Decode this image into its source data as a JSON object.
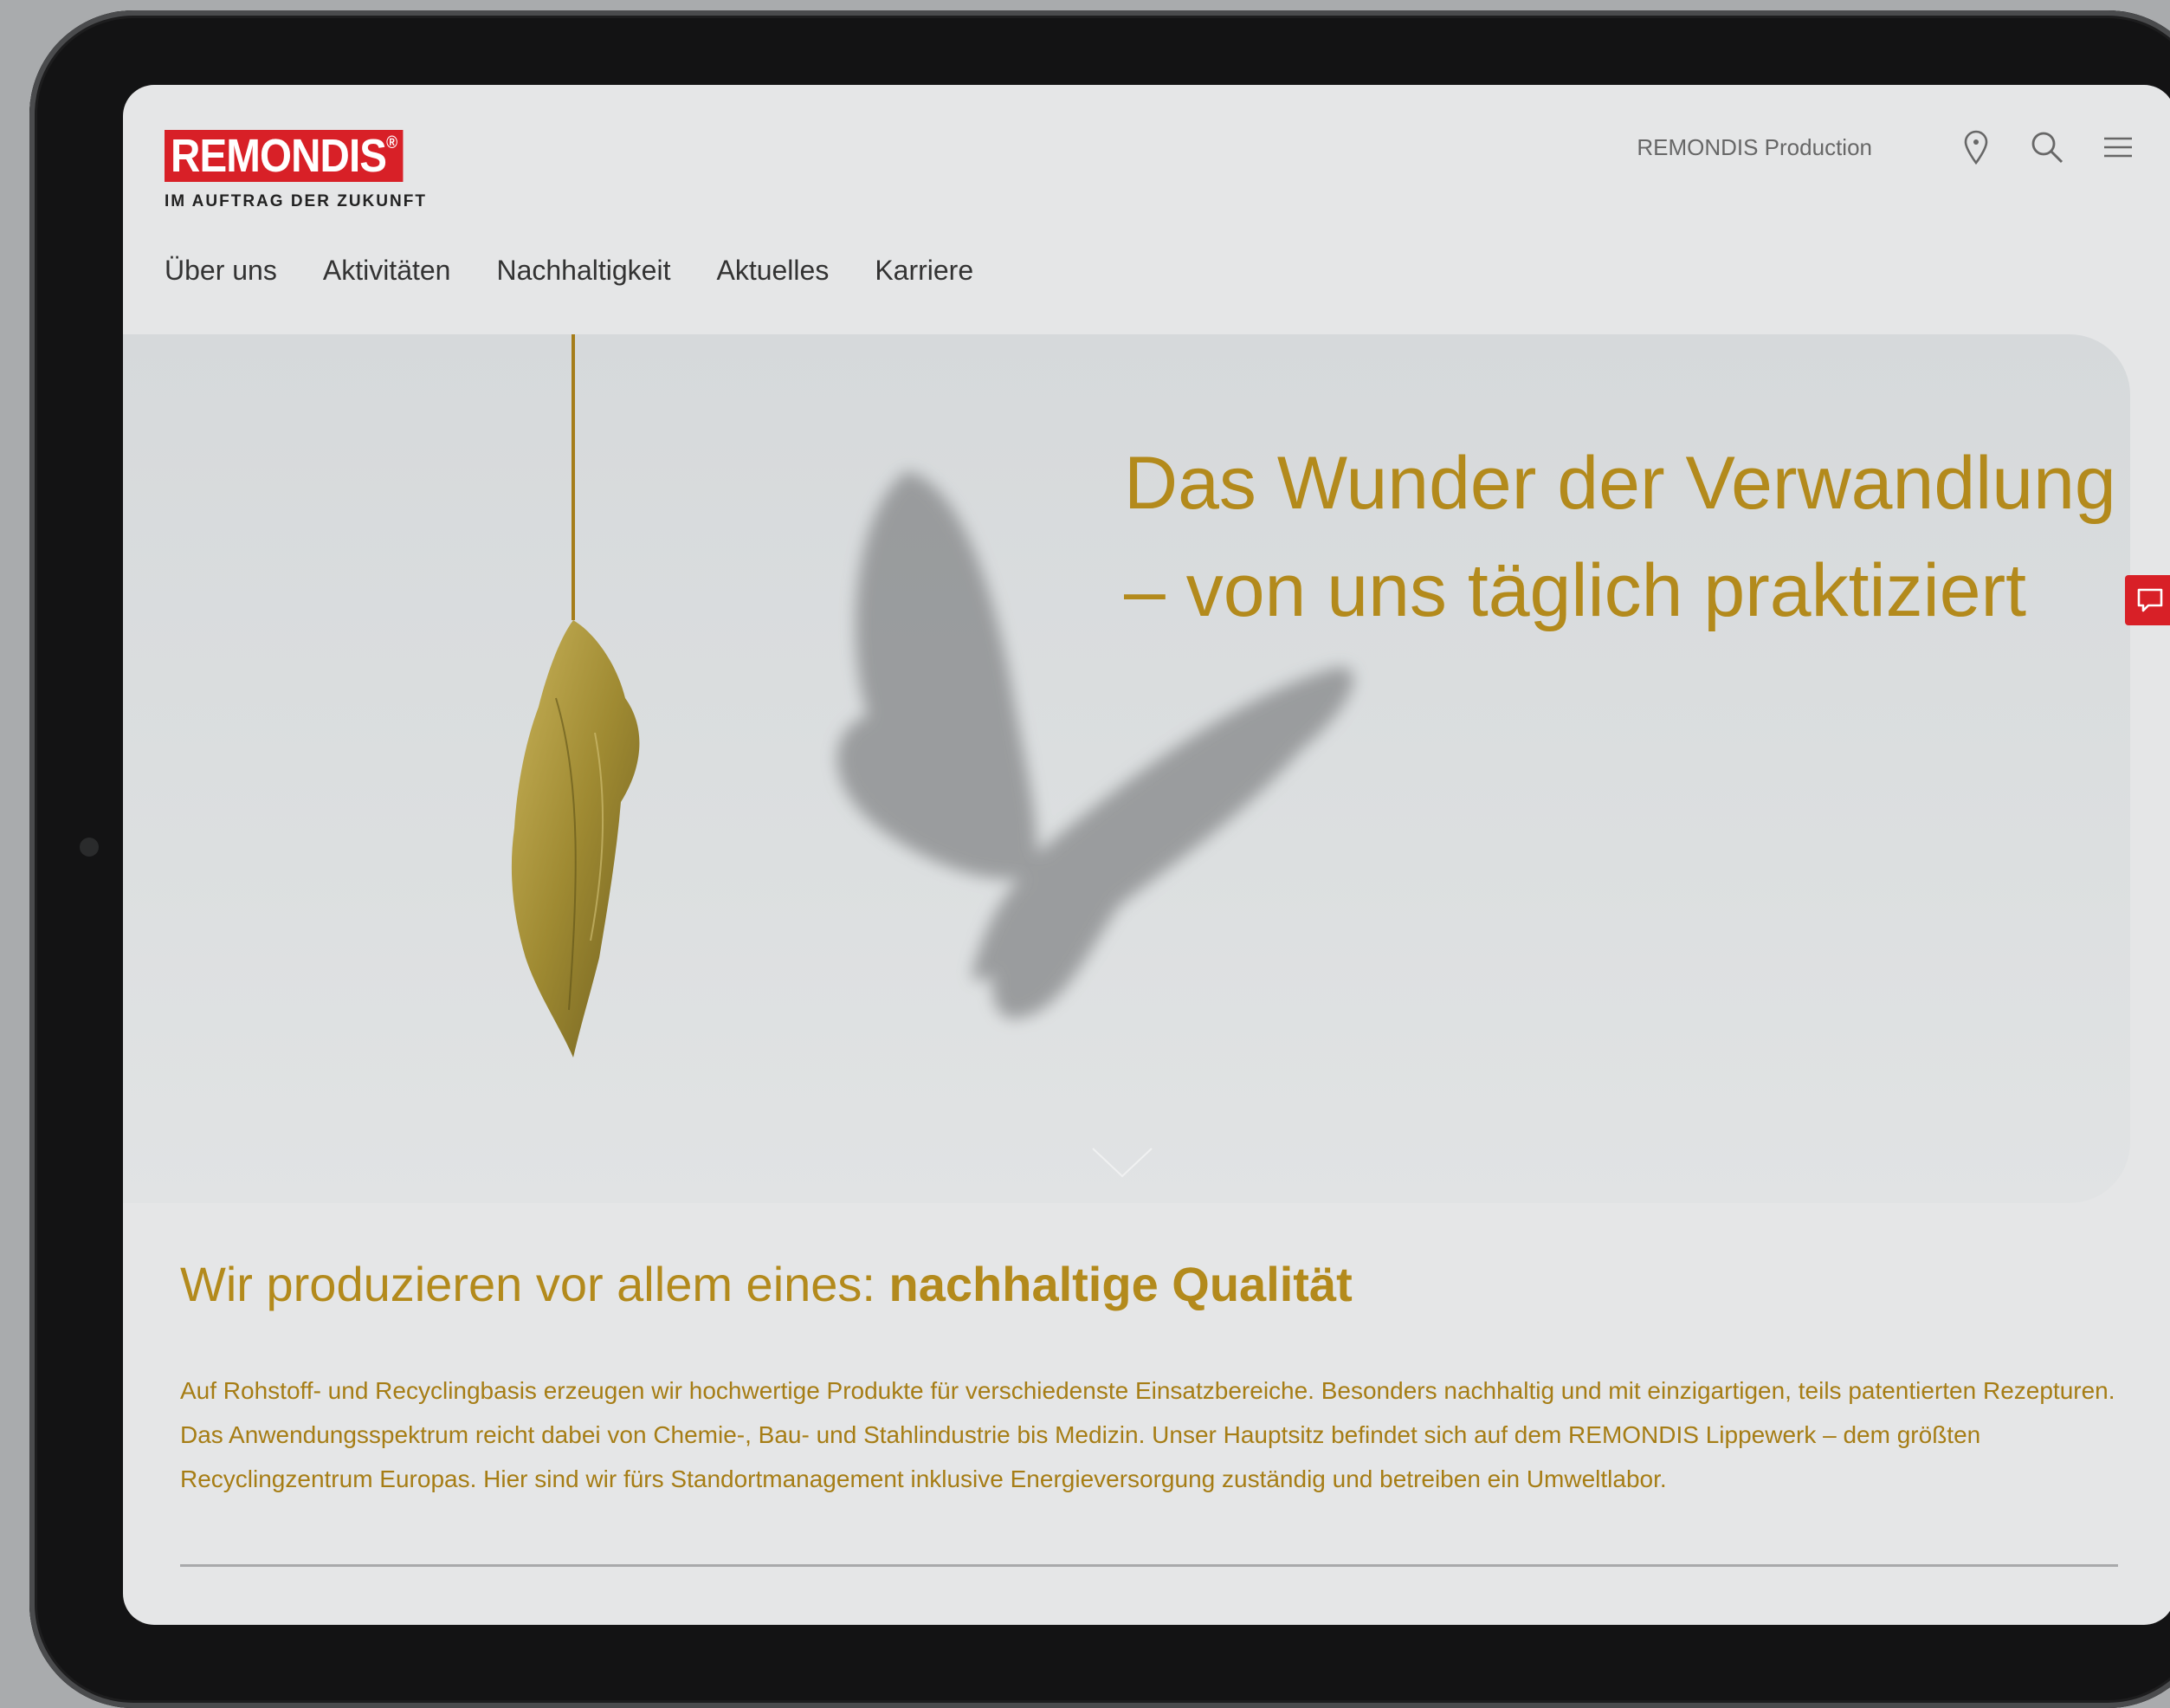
{
  "brand": {
    "name": "REMONDIS",
    "registered_mark": "®",
    "tagline": "IM AUFTRAG DER ZUKUNFT",
    "color": "#d82027"
  },
  "header": {
    "utility_link": "REMONDIS Production",
    "icons": [
      "location-pin-icon",
      "search-icon",
      "menu-icon"
    ]
  },
  "nav": {
    "items": [
      "Über uns",
      "Aktivitäten",
      "Nachhaltigkeit",
      "Aktuelles",
      "Karriere"
    ]
  },
  "hero": {
    "title_line1": "Das Wunder der Verwandlung",
    "title_line2": "– von uns täglich praktiziert",
    "accent_color": "#b38a1c",
    "image": "chrysalis-with-butterfly-shadow",
    "scroll_icon": "chevron-down-icon"
  },
  "side_tab": {
    "icon": "chat-icon"
  },
  "intro": {
    "heading_regular": "Wir produzieren vor allem eines: ",
    "heading_bold": "nachhaltige Qualität",
    "body": "Auf Rohstoff- und Recyclingbasis erzeugen wir hochwertige Produkte für verschiedenste Einsatzbereiche. Besonders nachhaltig und mit einzigartigen, teils patentierten Rezepturen. Das Anwendungsspektrum reicht dabei von Chemie-, Bau- und Stahlindustrie bis Medizin. Unser Hauptsitz befindet sich auf dem REMONDIS Lippewerk – dem größten Recyclingzentrum Europas. Hier sind wir fürs Standortmanagement inklusive Energieversorgung zuständig und betreiben ein Umweltlabor."
  }
}
